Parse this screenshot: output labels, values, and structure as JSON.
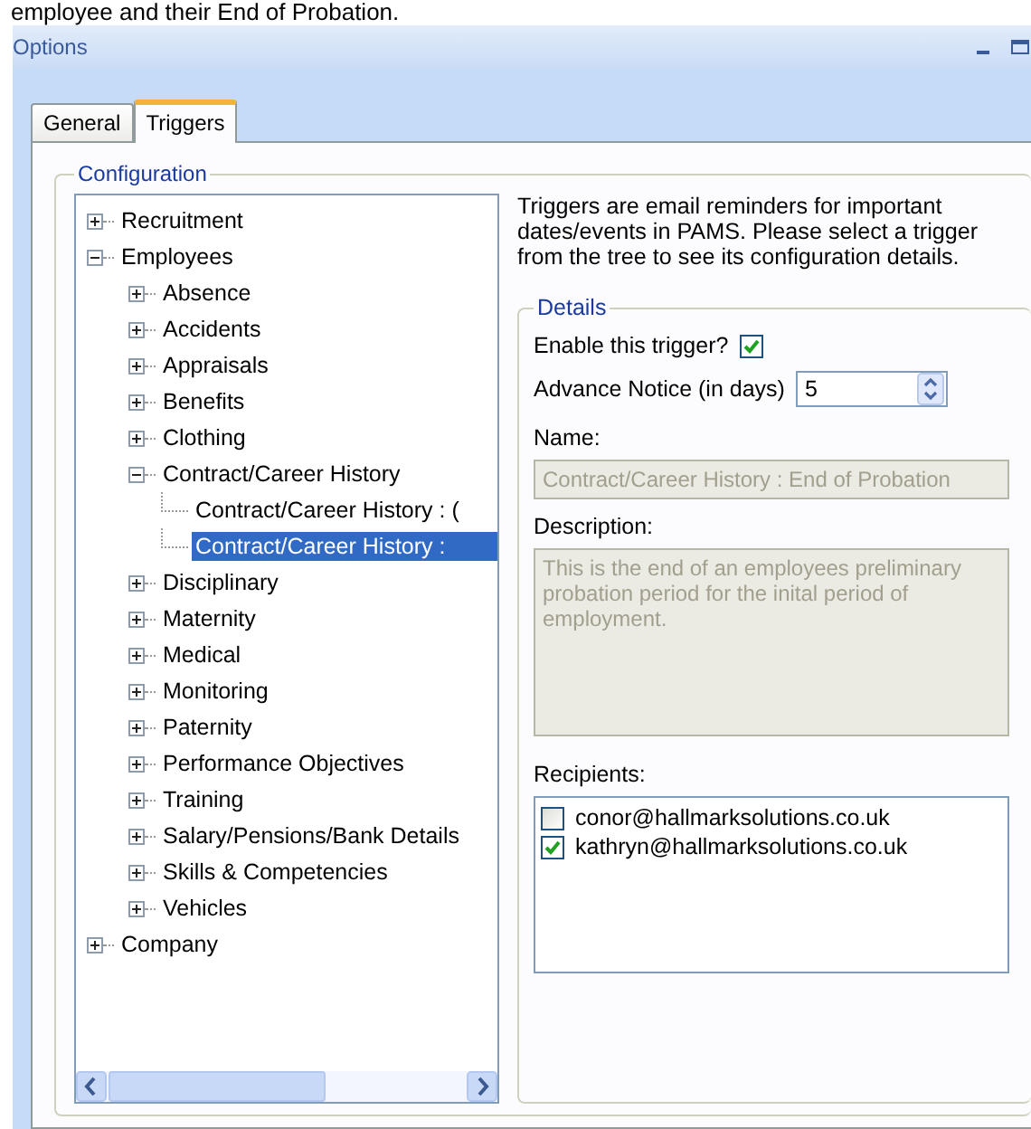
{
  "heading": "employee and their End of Probation.",
  "window": {
    "title": "Options"
  },
  "tabs": [
    {
      "label": "General",
      "selected": false
    },
    {
      "label": "Triggers",
      "selected": true
    }
  ],
  "configuration": {
    "title": "Configuration",
    "tree": [
      {
        "label": "Recruitment",
        "kind": "node",
        "expanded": false,
        "selected": false
      },
      {
        "label": "Employees",
        "kind": "node",
        "expanded": true,
        "selected": false,
        "children": [
          {
            "label": "Absence",
            "kind": "node",
            "expanded": false,
            "selected": false
          },
          {
            "label": "Accidents",
            "kind": "node",
            "expanded": false,
            "selected": false
          },
          {
            "label": "Appraisals",
            "kind": "node",
            "expanded": false,
            "selected": false
          },
          {
            "label": "Benefits",
            "kind": "node",
            "expanded": false,
            "selected": false
          },
          {
            "label": "Clothing",
            "kind": "node",
            "expanded": false,
            "selected": false
          },
          {
            "label": "Contract/Career History",
            "kind": "node",
            "expanded": true,
            "selected": false,
            "children": [
              {
                "label": "Contract/Career History : (",
                "kind": "leaf",
                "selected": false
              },
              {
                "label": "Contract/Career History :",
                "kind": "leaf",
                "selected": true
              }
            ]
          },
          {
            "label": "Disciplinary",
            "kind": "node",
            "expanded": false,
            "selected": false
          },
          {
            "label": "Maternity",
            "kind": "node",
            "expanded": false,
            "selected": false
          },
          {
            "label": "Medical",
            "kind": "node",
            "expanded": false,
            "selected": false
          },
          {
            "label": "Monitoring",
            "kind": "node",
            "expanded": false,
            "selected": false
          },
          {
            "label": "Paternity",
            "kind": "node",
            "expanded": false,
            "selected": false
          },
          {
            "label": "Performance Objectives",
            "kind": "node",
            "expanded": false,
            "selected": false
          },
          {
            "label": "Training",
            "kind": "node",
            "expanded": false,
            "selected": false
          },
          {
            "label": "Salary/Pensions/Bank Details",
            "kind": "node",
            "expanded": false,
            "selected": false
          },
          {
            "label": "Skills & Competencies",
            "kind": "node",
            "expanded": false,
            "selected": false
          },
          {
            "label": "Vehicles",
            "kind": "node",
            "expanded": false,
            "selected": false
          }
        ]
      },
      {
        "label": "Company",
        "kind": "node",
        "expanded": false,
        "selected": false
      }
    ],
    "intro": "Triggers are email reminders for important dates/events in PAMS. Please select a trigger from the tree to see its configuration details.",
    "details": {
      "title": "Details",
      "enable_label": "Enable this trigger?",
      "enable_checked": true,
      "notice_label": "Advance Notice (in days)",
      "notice_value": "5",
      "name_label": "Name:",
      "name_value": "Contract/Career History : End of Probation",
      "description_label": "Description:",
      "description_value": "This is the end of an employees preliminary probation period for the inital period of employment.",
      "recipients_label": "Recipients:",
      "recipients": [
        {
          "email": "conor@hallmarksolutions.co.uk",
          "checked": false
        },
        {
          "email": "kathryn@hallmarksolutions.co.uk",
          "checked": true
        }
      ]
    }
  }
}
